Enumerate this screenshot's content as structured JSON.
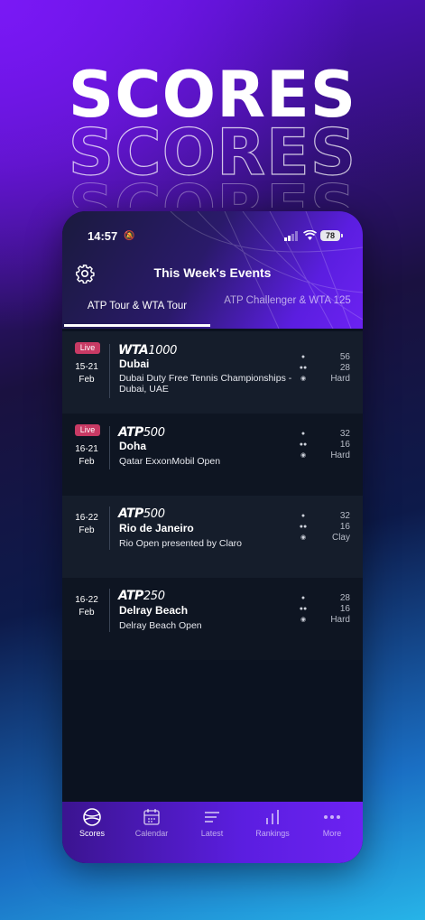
{
  "hero": {
    "headline": "SCORES"
  },
  "status_bar": {
    "time": "14:57",
    "battery": "78"
  },
  "screen": {
    "title": "This Week's Events"
  },
  "tabs": [
    {
      "label": "ATP Tour & WTA Tour",
      "active": true
    },
    {
      "label": "ATP Challenger & WTA 125",
      "active": false
    }
  ],
  "events": [
    {
      "live": "Live",
      "dates": "15-21",
      "month": "Feb",
      "tour": "WTA",
      "level": "1000",
      "city": "Dubai",
      "tournament": "Dubai Duty Free Tennis Championships - Dubai, UAE",
      "draw_singles": "56",
      "draw_doubles": "28",
      "surface": "Hard"
    },
    {
      "live": "Live",
      "dates": "16-21",
      "month": "Feb",
      "tour": "ATP",
      "level": "500",
      "city": "Doha",
      "tournament": "Qatar ExxonMobil Open",
      "draw_singles": "32",
      "draw_doubles": "16",
      "surface": "Hard"
    },
    {
      "live": "",
      "dates": "16-22",
      "month": "Feb",
      "tour": "ATP",
      "level": "500",
      "city": "Rio de Janeiro",
      "tournament": "Rio Open presented by Claro",
      "draw_singles": "32",
      "draw_doubles": "16",
      "surface": "Clay"
    },
    {
      "live": "",
      "dates": "16-22",
      "month": "Feb",
      "tour": "ATP",
      "level": "250",
      "city": "Delray Beach",
      "tournament": "Delray Beach Open",
      "draw_singles": "28",
      "draw_doubles": "16",
      "surface": "Hard"
    }
  ],
  "tabbar": [
    {
      "label": "Scores",
      "icon": "tennis-ball-icon",
      "active": true
    },
    {
      "label": "Calendar",
      "icon": "calendar-icon",
      "active": false
    },
    {
      "label": "Latest",
      "icon": "lines-icon",
      "active": false
    },
    {
      "label": "Rankings",
      "icon": "bar-chart-icon",
      "active": false
    },
    {
      "label": "More",
      "icon": "more-dots-icon",
      "active": false
    }
  ],
  "colors": {
    "accent": "#6c22f2",
    "live_badge": "#c83a64",
    "background_dark": "#0b1220"
  }
}
